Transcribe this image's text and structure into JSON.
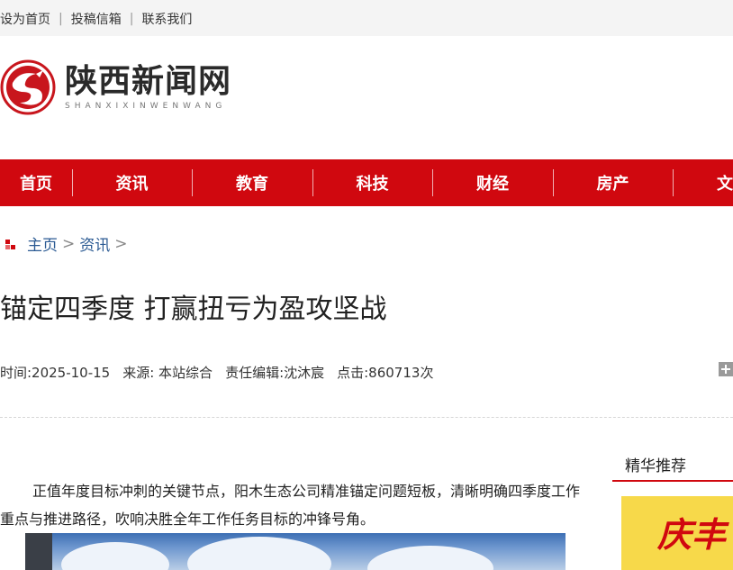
{
  "topbar": {
    "links": [
      "设为首页",
      "投稿信箱",
      "联系我们"
    ]
  },
  "logo": {
    "name_cn": "陕西新闻网",
    "name_en": "SHANXIXINWENWANG"
  },
  "nav": {
    "items": [
      "首页",
      "资讯",
      "教育",
      "科技",
      "财经",
      "房产",
      "文"
    ]
  },
  "breadcrumb": {
    "home": "主页",
    "sep": ">",
    "section": "资讯"
  },
  "article": {
    "title": "锚定四季度 打赢扭亏为盈攻坚战",
    "time": "时间:2025-10-15",
    "source": "来源: 本站综合",
    "editor": "责任编辑:沈沐宸",
    "clicks": "点击:860713次",
    "paragraph": "正值年度目标冲刺的关键节点，阳木生态公司精准锚定问题短板，清晰明确四季度工作重点与推进路径，吹响决胜全年工作任务目标的冲锋号角。"
  },
  "sidebar": {
    "title": "精华推荐",
    "image_text": "庆丰"
  },
  "colors": {
    "brand_red": "#d0080f",
    "link_blue": "#2b5a93"
  }
}
